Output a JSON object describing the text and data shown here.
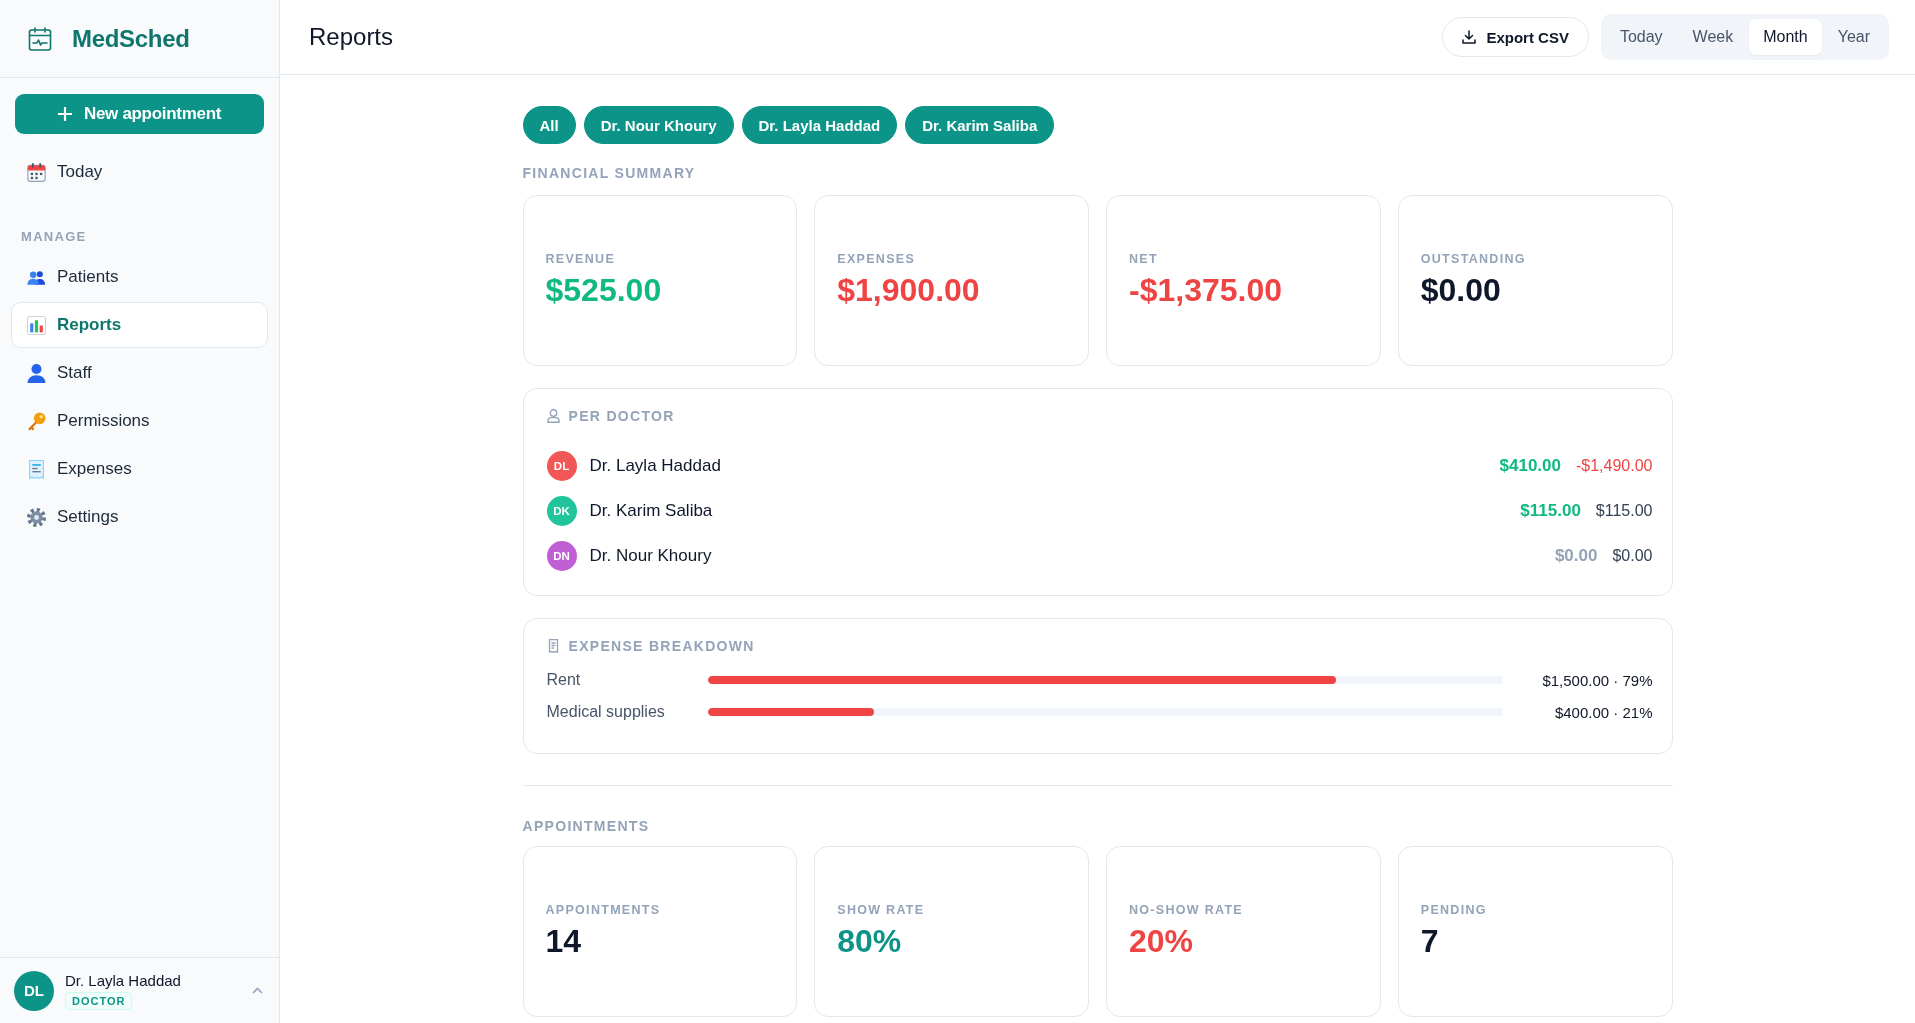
{
  "sidebar": {
    "brand": "MedSched",
    "new_button": "New appointment",
    "top_items": [
      {
        "label": "Today",
        "selected": false
      }
    ],
    "section_label": "MANAGE",
    "items": [
      {
        "label": "Patients",
        "selected": false
      },
      {
        "label": "Reports",
        "selected": true
      },
      {
        "label": "Staff",
        "selected": false
      },
      {
        "label": "Permissions",
        "selected": false
      },
      {
        "label": "Expenses",
        "selected": false
      },
      {
        "label": "Settings",
        "selected": false
      }
    ],
    "user": {
      "initials": "DL",
      "name": "Dr. Layla Haddad",
      "role": "DOCTOR"
    }
  },
  "header": {
    "title": "Reports",
    "export_button": "Export CSV",
    "periods": [
      {
        "label": "Today",
        "selected": false
      },
      {
        "label": "Week",
        "selected": false
      },
      {
        "label": "Month",
        "selected": true
      },
      {
        "label": "Year",
        "selected": false
      }
    ]
  },
  "filters": [
    {
      "label": "All",
      "selected": true
    },
    {
      "label": "Dr. Nour Khoury",
      "selected": true
    },
    {
      "label": "Dr. Layla Haddad",
      "selected": true
    },
    {
      "label": "Dr. Karim Saliba",
      "selected": true
    }
  ],
  "financial_summary": {
    "title": "FINANCIAL SUMMARY",
    "cards": [
      {
        "label": "REVENUE",
        "value": "$525.00",
        "color": "#10b981"
      },
      {
        "label": "EXPENSES",
        "value": "$1,900.00",
        "color": "#ef4444"
      },
      {
        "label": "NET",
        "value": "-$1,375.00",
        "color": "#ef4444"
      },
      {
        "label": "OUTSTANDING",
        "value": "$0.00",
        "color": "#0f172a"
      }
    ]
  },
  "per_doctor": {
    "title": "PER DOCTOR",
    "rows": [
      {
        "initials": "DL",
        "name": "Dr. Layla Haddad",
        "color": "#f25757",
        "revenue": {
          "value": "$410.00",
          "color": "#10b981"
        },
        "net": {
          "value": "-$1,490.00",
          "color": "#ef4444"
        }
      },
      {
        "initials": "DK",
        "name": "Dr. Karim Saliba",
        "color": "#22c59b",
        "revenue": {
          "value": "$115.00",
          "color": "#10b981"
        },
        "net": {
          "value": "$115.00",
          "color": "#334155"
        }
      },
      {
        "initials": "DN",
        "name": "Dr. Nour Khoury",
        "color": "#c05fd3",
        "revenue": {
          "value": "$0.00",
          "color": "#94a3b8"
        },
        "net": {
          "value": "$0.00",
          "color": "#334155"
        }
      }
    ]
  },
  "expense_breakdown": {
    "title": "EXPENSE BREAKDOWN",
    "rows": [
      {
        "label": "Rent",
        "level": 0.79,
        "reading": "$1,500.00 · 79%"
      },
      {
        "label": "Medical supplies",
        "level": 0.21,
        "reading": "$400.00 · 21%"
      }
    ]
  },
  "appointments": {
    "title": "APPOINTMENTS",
    "cards": [
      {
        "label": "APPOINTMENTS",
        "value": "14",
        "color": "#0f172a"
      },
      {
        "label": "SHOW RATE",
        "value": "80%",
        "color": "#0d9488"
      },
      {
        "label": "NO-SHOW RATE",
        "value": "20%",
        "color": "#ef4444"
      },
      {
        "label": "PENDING",
        "value": "7",
        "color": "#0f172a"
      }
    ]
  }
}
